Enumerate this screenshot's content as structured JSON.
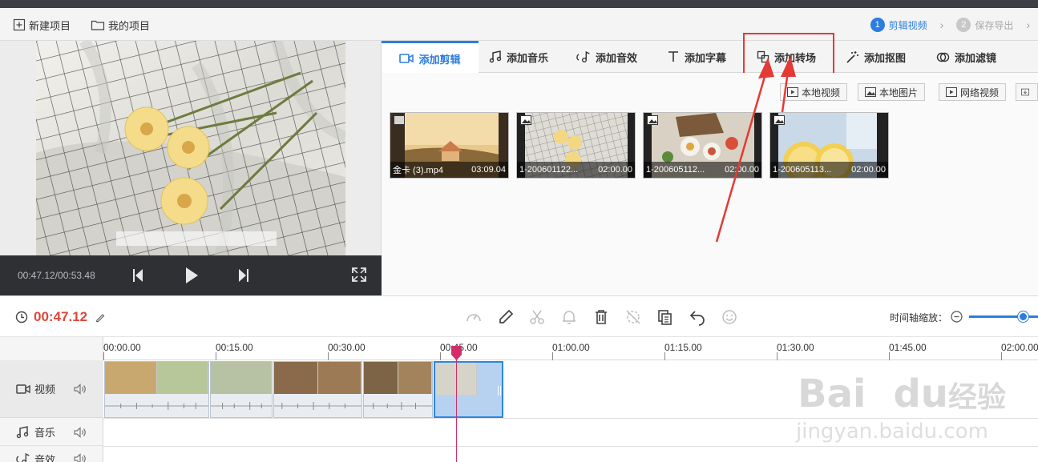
{
  "topbar": {
    "new_project": "新建项目",
    "my_projects": "我的项目",
    "steps": [
      {
        "num": "1",
        "label": "剪辑视频"
      },
      {
        "num": "2",
        "label": "保存导出"
      }
    ]
  },
  "preview": {
    "time": "00:47.12/00:53.48"
  },
  "tabs": [
    {
      "label": "添加剪辑"
    },
    {
      "label": "添加音乐"
    },
    {
      "label": "添加音效"
    },
    {
      "label": "添加字幕"
    },
    {
      "label": "添加转场"
    },
    {
      "label": "添加抠图"
    },
    {
      "label": "添加滤镜"
    }
  ],
  "sources": {
    "local_video": "本地视频",
    "local_image": "本地图片",
    "web_video": "网络视频"
  },
  "media": [
    {
      "name": "金卡 (3).mp4",
      "duration": "03:09.04"
    },
    {
      "name": "1-200601122...",
      "duration": "02:00.00"
    },
    {
      "name": "1-200605112...",
      "duration": "02:00.00"
    },
    {
      "name": "1-200605113...",
      "duration": "02:00.00"
    }
  ],
  "timeline": {
    "current_time": "00:47.12",
    "zoom_label": "时间轴缩放：",
    "zoom_level": 0.85,
    "ticks": [
      "00:00.00",
      "00:15.00",
      "00:30.00",
      "00:45.00",
      "01:00.00",
      "01:15.00",
      "01:30.00",
      "01:45.00",
      "02:00.00"
    ],
    "tracks": [
      {
        "label": "视频"
      },
      {
        "label": "音乐"
      },
      {
        "label": "音效"
      }
    ]
  },
  "watermark": {
    "line1": "Bai",
    "line2": "du",
    "line3": "经验",
    "url": "jingyan.baidu.com"
  },
  "colors": {
    "accent": "#2b7de0",
    "time_red": "#e0463a",
    "playhead": "#d22d6a",
    "highlight": "#e53935"
  }
}
